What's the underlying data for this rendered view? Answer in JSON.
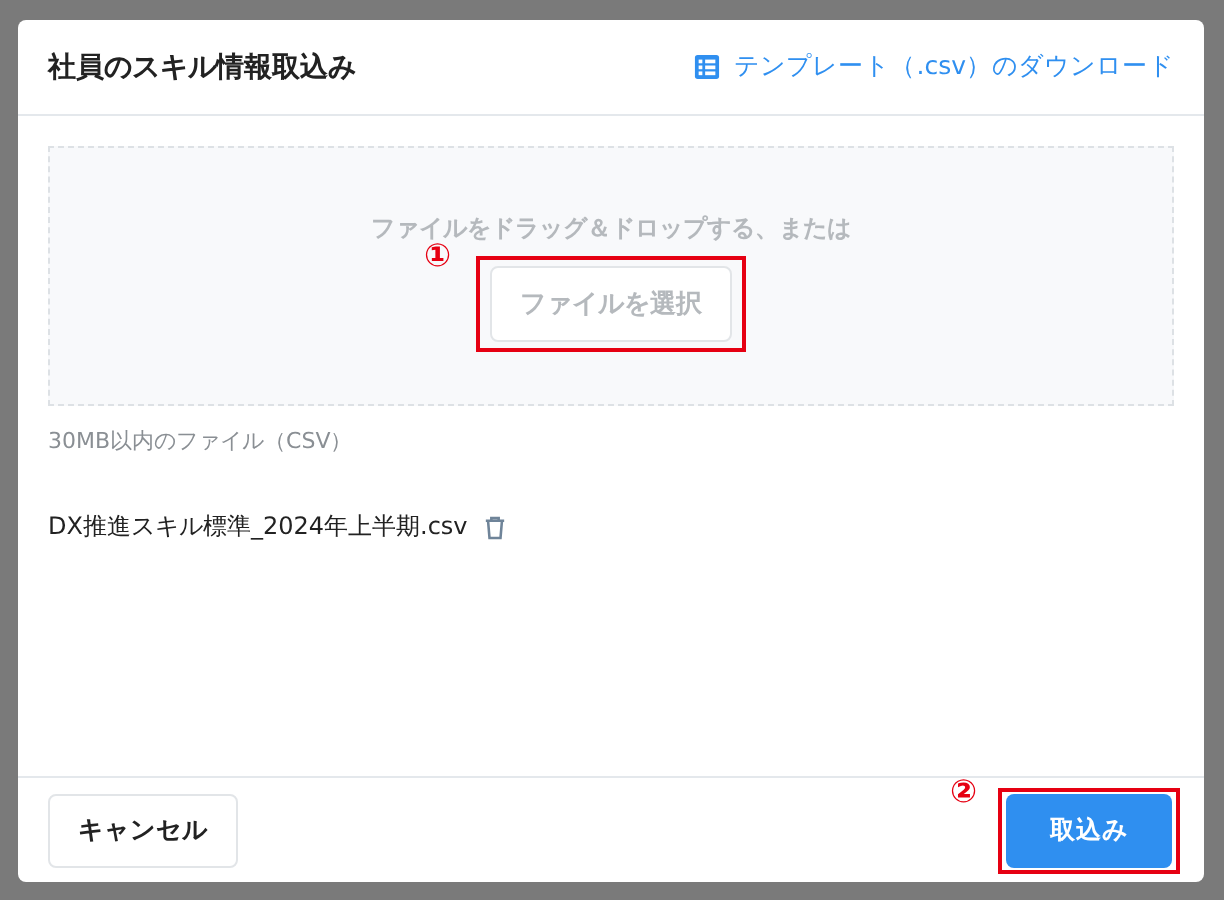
{
  "dialog": {
    "title": "社員のスキル情報取込み",
    "template_link": "テンプレート（.csv）のダウンロード",
    "dropzone": {
      "prompt": "ファイルをドラッグ＆ドロップする、または",
      "button": "ファイルを選択",
      "callout": "①"
    },
    "hint": "30MB以内のファイル（CSV）",
    "files": [
      {
        "name": "DX推進スキル標準_2024年上半期.csv"
      }
    ],
    "buttons": [
      {
        "label": "キャンセル",
        "kind": "secondary"
      },
      {
        "label": "取込み",
        "kind": "primary",
        "callout": "②"
      }
    ]
  }
}
